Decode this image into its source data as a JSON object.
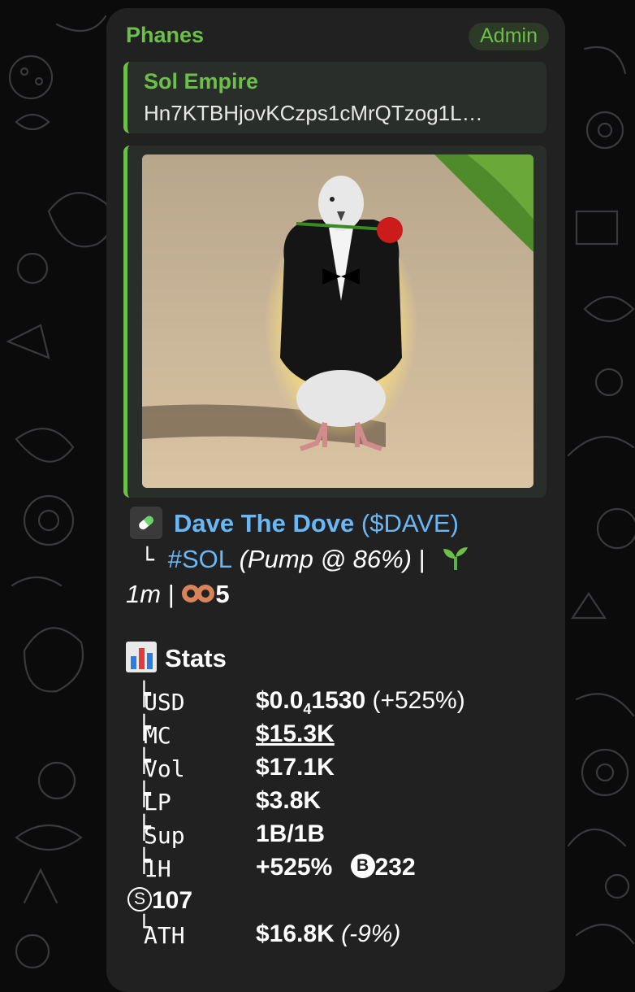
{
  "message": {
    "sender": "Phanes",
    "badge": "Admin"
  },
  "reply": {
    "title": "Sol Empire",
    "text": "Hn7KTBHjovKCzps1cMrQTzog1L…"
  },
  "token": {
    "name": "Dave The Dove",
    "ticker_open": " (",
    "ticker": "$DAVE",
    "ticker_close": ")",
    "chain_tag": "#SOL",
    "pump_text": " (Pump @ 86%)",
    "sep": " |",
    "age": "1m",
    "age_sep": " | ",
    "holders_icon_count": "5"
  },
  "stats": {
    "header": "Stats",
    "rows": [
      {
        "label": "USD",
        "value_pre": "$0.0",
        "value_sub": "4",
        "value_post": "1530",
        "change": " (+525%)"
      },
      {
        "label": "MC",
        "value": "$15.3K"
      },
      {
        "label": "Vol",
        "value": "$17.1K"
      },
      {
        "label": "LP",
        "value": "$3.8K"
      },
      {
        "label": "Sup",
        "value": "1B/1B"
      },
      {
        "label": "1H",
        "value": "+525%",
        "buys_icon": "B",
        "buys": "232",
        "sells_icon": "S",
        "sells": "107"
      },
      {
        "label": "ATH",
        "value": "$16.8K",
        "change": " (-9%)"
      }
    ]
  },
  "colors": {
    "accent_green": "#6cc04a",
    "link_blue": "#6ab7f5",
    "bubble_bg": "#212121",
    "page_bg": "#0b0b0c"
  }
}
